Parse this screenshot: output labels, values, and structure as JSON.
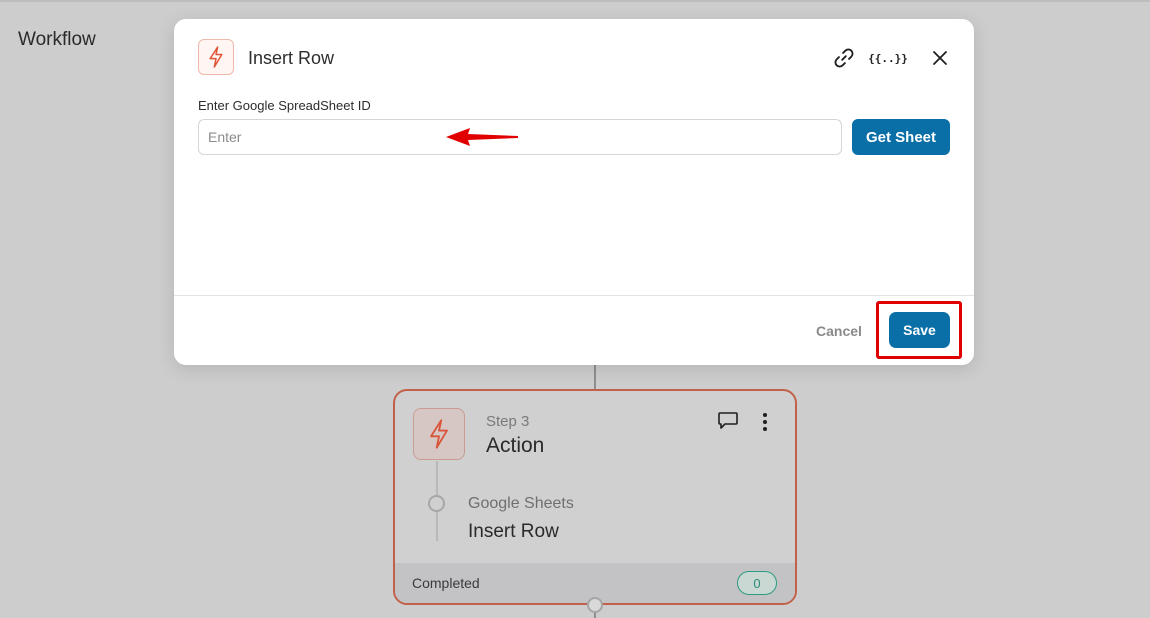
{
  "page": {
    "title": "Workflow"
  },
  "modal": {
    "title": "Insert Row",
    "icon": "lightning-bolt-icon",
    "header_icons": [
      "link-icon",
      "variables-icon",
      "close-icon"
    ],
    "variables_glyph": "{{..}}",
    "field_label": "Enter Google SpreadSheet ID",
    "input_placeholder": "Enter",
    "input_value": "",
    "get_sheet_label": "Get Sheet",
    "cancel_label": "Cancel",
    "save_label": "Save",
    "annotation_color": "#e00000"
  },
  "step_card": {
    "step_label": "Step 3",
    "title": "Action",
    "icon": "lightning-bolt-icon",
    "app_name": "Google Sheets",
    "action_name": "Insert Row",
    "status_label": "Completed",
    "count": "0"
  },
  "colors": {
    "primary": "#0a6fa6",
    "accent": "#e0553a",
    "badge": "#2e9a83"
  }
}
